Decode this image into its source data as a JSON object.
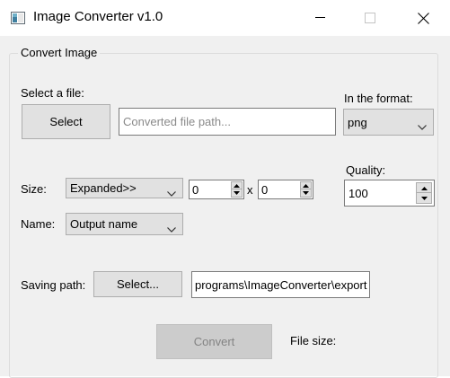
{
  "window": {
    "title": "Image Converter v1.0",
    "icon": "app-window-icon",
    "controls": [
      "minimize-icon",
      "maximize-icon",
      "close-icon"
    ]
  },
  "group": {
    "title": "Convert Image"
  },
  "file_select": {
    "label": "Select a file:",
    "button_label": "Select",
    "path_placeholder": "Converted file path...",
    "path_value": ""
  },
  "format": {
    "label": "In the format:",
    "selected": "png"
  },
  "size": {
    "label": "Size:",
    "mode": "Expanded>>",
    "width": "0",
    "separator": "x",
    "height": "0"
  },
  "quality": {
    "label": "Quality:",
    "value": "100"
  },
  "name": {
    "label": "Name:",
    "selected": "Output name"
  },
  "saving_path": {
    "label": "Saving path:",
    "button_label": "Select...",
    "value": "programs\\ImageConverter\\export"
  },
  "convert": {
    "button_label": "Convert",
    "enabled": false
  },
  "file_size": {
    "label": "File size:",
    "value": ""
  },
  "colors": {
    "window_bg": "#f0f0f0",
    "titlebar_bg": "#ffffff",
    "button_bg": "#e1e1e1",
    "button_border": "#adadad",
    "input_border": "#7a7a7a",
    "disabled_button_bg": "#cccccc",
    "disabled_text": "#838383",
    "placeholder_text": "#8a8a8a"
  }
}
